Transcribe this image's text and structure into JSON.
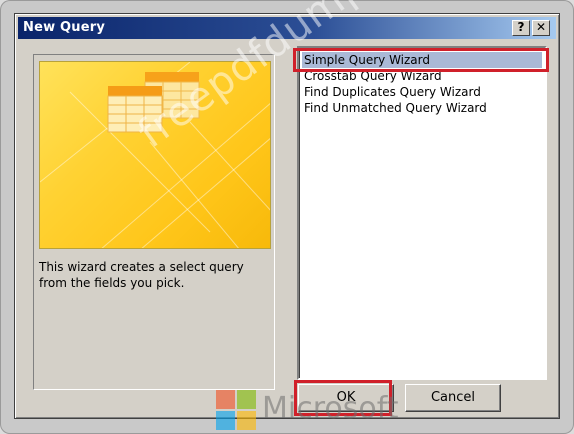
{
  "dialog": {
    "title": "New Query",
    "help_button": "?",
    "close_button": "✕"
  },
  "description": "This wizard creates a select query from the fields you pick.",
  "wizards": [
    {
      "label": "Simple Query Wizard",
      "selected": true
    },
    {
      "label": "Crosstab Query Wizard",
      "selected": false
    },
    {
      "label": "Find Duplicates Query Wizard",
      "selected": false
    },
    {
      "label": "Find Unmatched Query Wizard",
      "selected": false
    }
  ],
  "buttons": {
    "ok": "OK",
    "cancel": "Cancel"
  },
  "watermark": {
    "site": "freepdfdumps.com",
    "brand": "Microsoft"
  },
  "colors": {
    "selection": "#aab9d6",
    "highlight_box": "#d0202a",
    "preview_yellow": "#ffd233"
  }
}
